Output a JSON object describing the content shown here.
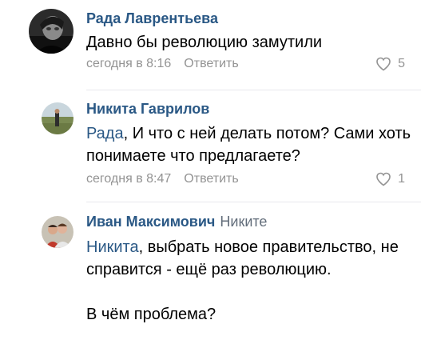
{
  "comments": [
    {
      "author": "Рада Лаврентьева",
      "text": "Давно бы революцию замутили",
      "time": "сегодня в 8:16",
      "reply_label": "Ответить",
      "likes": "5"
    },
    {
      "author": "Никита Гаврилов",
      "mention": "Рада",
      "text": ", И что с ней делать потом? Сами хоть понимаете что предлагаете?",
      "time": "сегодня в 8:47",
      "reply_label": "Ответить",
      "likes": "1"
    },
    {
      "author": "Иван Максимович",
      "reply_to": "Никите",
      "mention": "Никита",
      "text": ", выбрать новое правительство, не справится - ещё раз революцию.",
      "text2": "В чём проблема?"
    }
  ],
  "colors": {
    "link": "#2a5885",
    "meta": "#939393",
    "divider": "#e7e8ec"
  },
  "icons": [
    "heart-icon"
  ]
}
